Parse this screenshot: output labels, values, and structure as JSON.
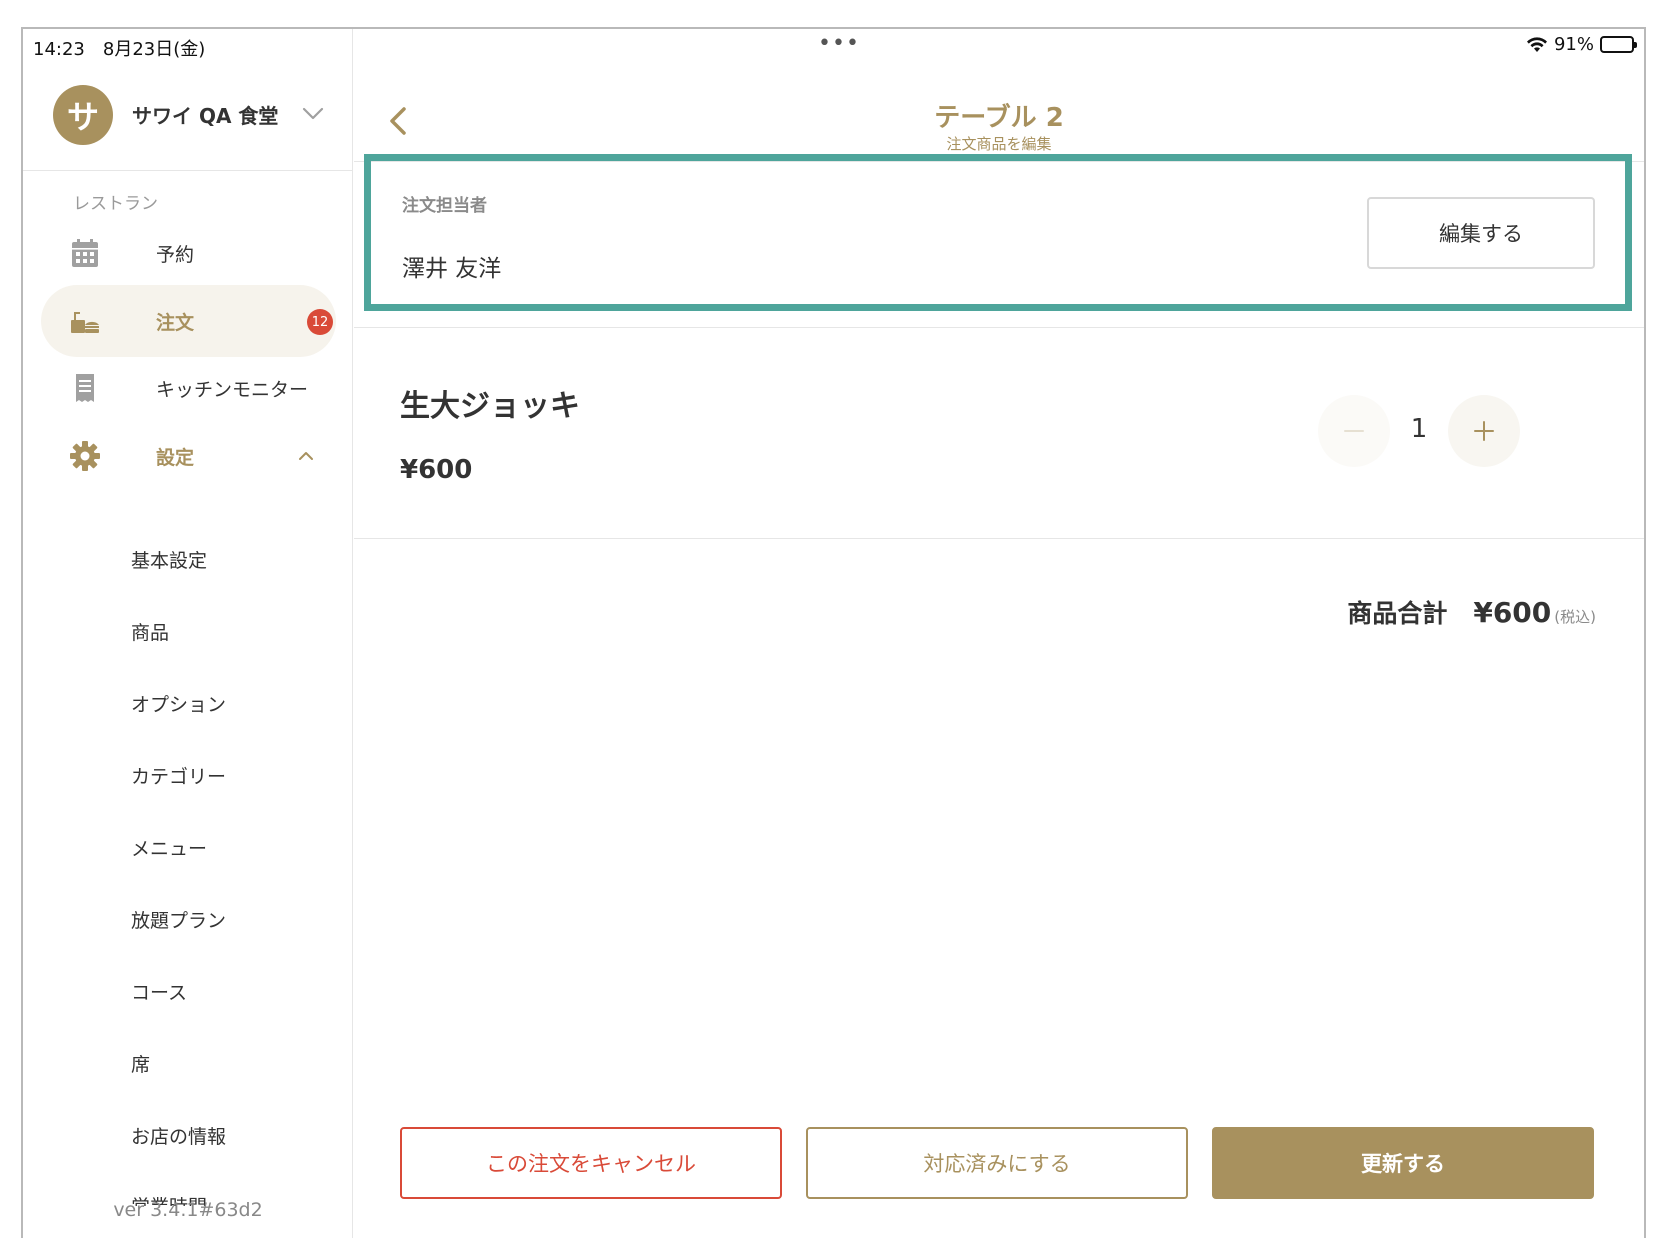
{
  "status_bar": {
    "time": "14:23　8月23日(金)",
    "dots": "•••",
    "battery": "91%",
    "battery_level": 0.91
  },
  "sidebar": {
    "shop": {
      "avatar_letter": "サ",
      "name": "サワイ QA 食堂"
    },
    "section_label": "レストラン",
    "nav": [
      {
        "label": "予約",
        "icon": "calendar-icon"
      },
      {
        "label": "注文",
        "icon": "order-tray-icon",
        "badge": "12"
      },
      {
        "label": "キッチンモニター",
        "icon": "receipt-icon"
      },
      {
        "label": "設定",
        "icon": "gear-icon"
      }
    ],
    "settings_items": [
      "基本設定",
      "商品",
      "オプション",
      "カテゴリー",
      "メニュー",
      "放題プラン",
      "コース",
      "席",
      "お店の情報",
      "営業時間"
    ],
    "version": "ver 3.4.1#63d2"
  },
  "header": {
    "title": "テーブル 2",
    "subtitle": "注文商品を編集"
  },
  "staff": {
    "label": "注文担当者",
    "name": "澤井 友洋",
    "edit_label": "編集する"
  },
  "order_item": {
    "name": "生大ジョッキ",
    "price": "¥600",
    "quantity": "1"
  },
  "total": {
    "label": "商品合計",
    "value": "¥600",
    "tax": "(税込)"
  },
  "actions": {
    "cancel": "この注文をキャンセル",
    "done": "対応済みにする",
    "update": "更新する"
  },
  "colors": {
    "accent": "#a8915e",
    "danger": "#d94a38",
    "highlight": "#4ea59b"
  }
}
